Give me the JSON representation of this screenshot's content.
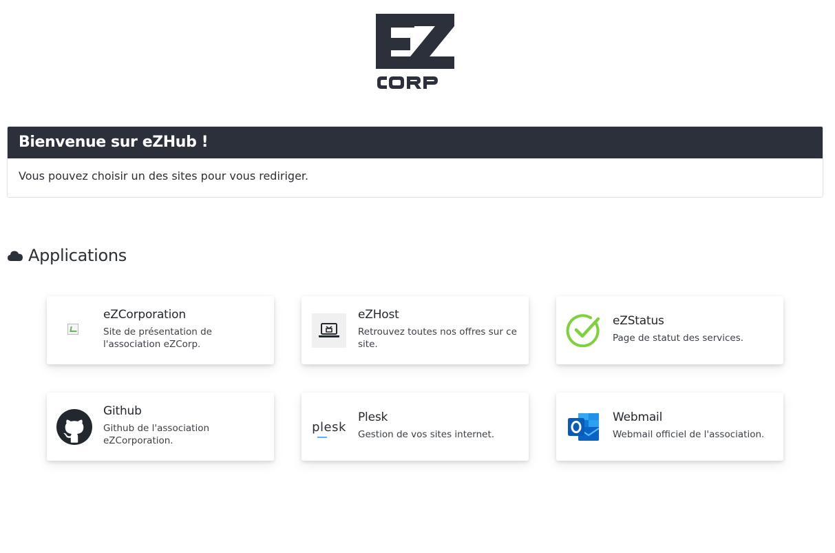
{
  "logo": {
    "alt": "eZ CORP",
    "top_text": "EZ",
    "bottom_text": "CORP"
  },
  "welcome": {
    "title": "Bienvenue sur eZHub !",
    "message": "Vous pouvez choisir un des sites pour vous rediriger."
  },
  "applications": {
    "title": "Applications",
    "icon": "cloud-icon",
    "cards": [
      {
        "title": "eZCorporation",
        "description": "Site de présentation de l'association eZCorp.",
        "icon": "broken-image-icon"
      },
      {
        "title": "eZHost",
        "description": "Retrouvez toutes nos offres sur ce site.",
        "icon": "laptop-icon"
      },
      {
        "title": "eZStatus",
        "description": "Page de statut des services.",
        "icon": "check-circle-icon"
      },
      {
        "title": "Github",
        "description": "Github de l'association eZCorporation.",
        "icon": "github-icon"
      },
      {
        "title": "Plesk",
        "description": "Gestion de vos sites internet.",
        "icon": "plesk-icon",
        "icon_text": "plesk"
      },
      {
        "title": "Webmail",
        "description": "Webmail officiel de l'association.",
        "icon": "outlook-icon"
      }
    ]
  },
  "colors": {
    "header_bg": "#2b303a",
    "status_green": "#7dd13a",
    "outlook_blue": "#0a64c8"
  }
}
